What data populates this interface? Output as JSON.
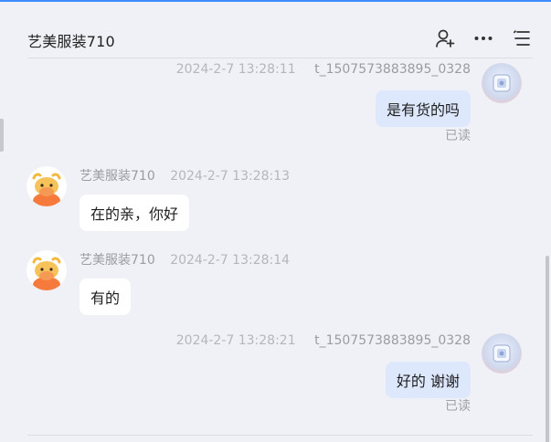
{
  "header": {
    "title": "艺美服装710",
    "icons": [
      "add-person-icon",
      "more-dots-icon",
      "menu-list-icon"
    ]
  },
  "messages": [
    {
      "direction": "out",
      "sender": "t_1507573883895_0328",
      "time": "2024-2-7 13:28:11",
      "text": "是有货的吗",
      "status": "已读"
    },
    {
      "direction": "in",
      "sender": "艺美服装710",
      "time": "2024-2-7 13:28:13",
      "text": "在的亲，你好"
    },
    {
      "direction": "in",
      "sender": "艺美服装710",
      "time": "2024-2-7 13:28:14",
      "text": "有的"
    },
    {
      "direction": "out",
      "sender": "t_1507573883895_0328",
      "time": "2024-2-7 13:28:21",
      "text": "好的 谢谢",
      "status": "已读"
    }
  ],
  "colors": {
    "accent": "#3d8bff",
    "bubble_out": "#dde8fd",
    "bubble_in": "#ffffff",
    "background": "#f0f1f6"
  }
}
